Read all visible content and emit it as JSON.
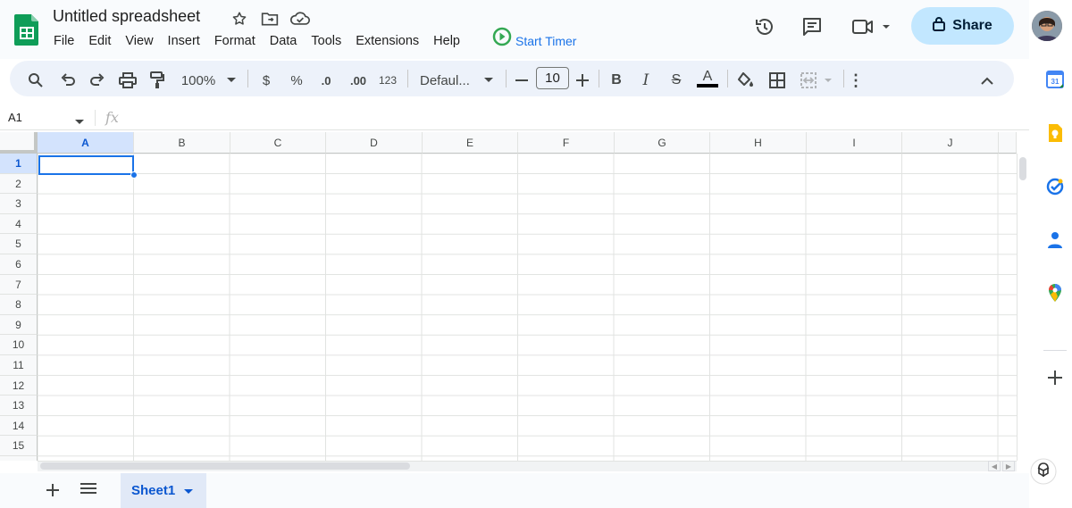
{
  "document": {
    "title": "Untitled spreadsheet"
  },
  "menu": [
    "File",
    "Edit",
    "View",
    "Insert",
    "Format",
    "Data",
    "Tools",
    "Extensions",
    "Help"
  ],
  "timer": {
    "label": "Start Timer"
  },
  "share": {
    "label": "Share"
  },
  "toolbar": {
    "zoom": "100%",
    "currency": "$",
    "percent": "%",
    "decrease_decimal": ".0",
    "increase_decimal": ".00",
    "number_format": "123",
    "font": "Defaul...",
    "font_size": "10",
    "bold": "B",
    "italic": "I",
    "strikethrough": "S",
    "text_color": "A",
    "more": "⋮"
  },
  "formula_bar": {
    "cell_ref": "A1",
    "fx": "fx"
  },
  "columns": [
    "A",
    "B",
    "C",
    "D",
    "E",
    "F",
    "G",
    "H",
    "I",
    "J"
  ],
  "rows": [
    "1",
    "2",
    "3",
    "4",
    "5",
    "6",
    "7",
    "8",
    "9",
    "10",
    "11",
    "12",
    "13",
    "14",
    "15"
  ],
  "selected_cell": "A1",
  "sheets": [
    {
      "name": "Sheet1",
      "active": true
    }
  ],
  "colors": {
    "accent": "#1a73e8",
    "share_bg": "#c2e7ff",
    "toolbar_bg": "#edf2fa",
    "sheets_green": "#0f9d58"
  },
  "side_icons": [
    "calendar-icon",
    "keep-icon",
    "tasks-icon",
    "contacts-icon",
    "maps-icon",
    "add-addon-icon"
  ]
}
